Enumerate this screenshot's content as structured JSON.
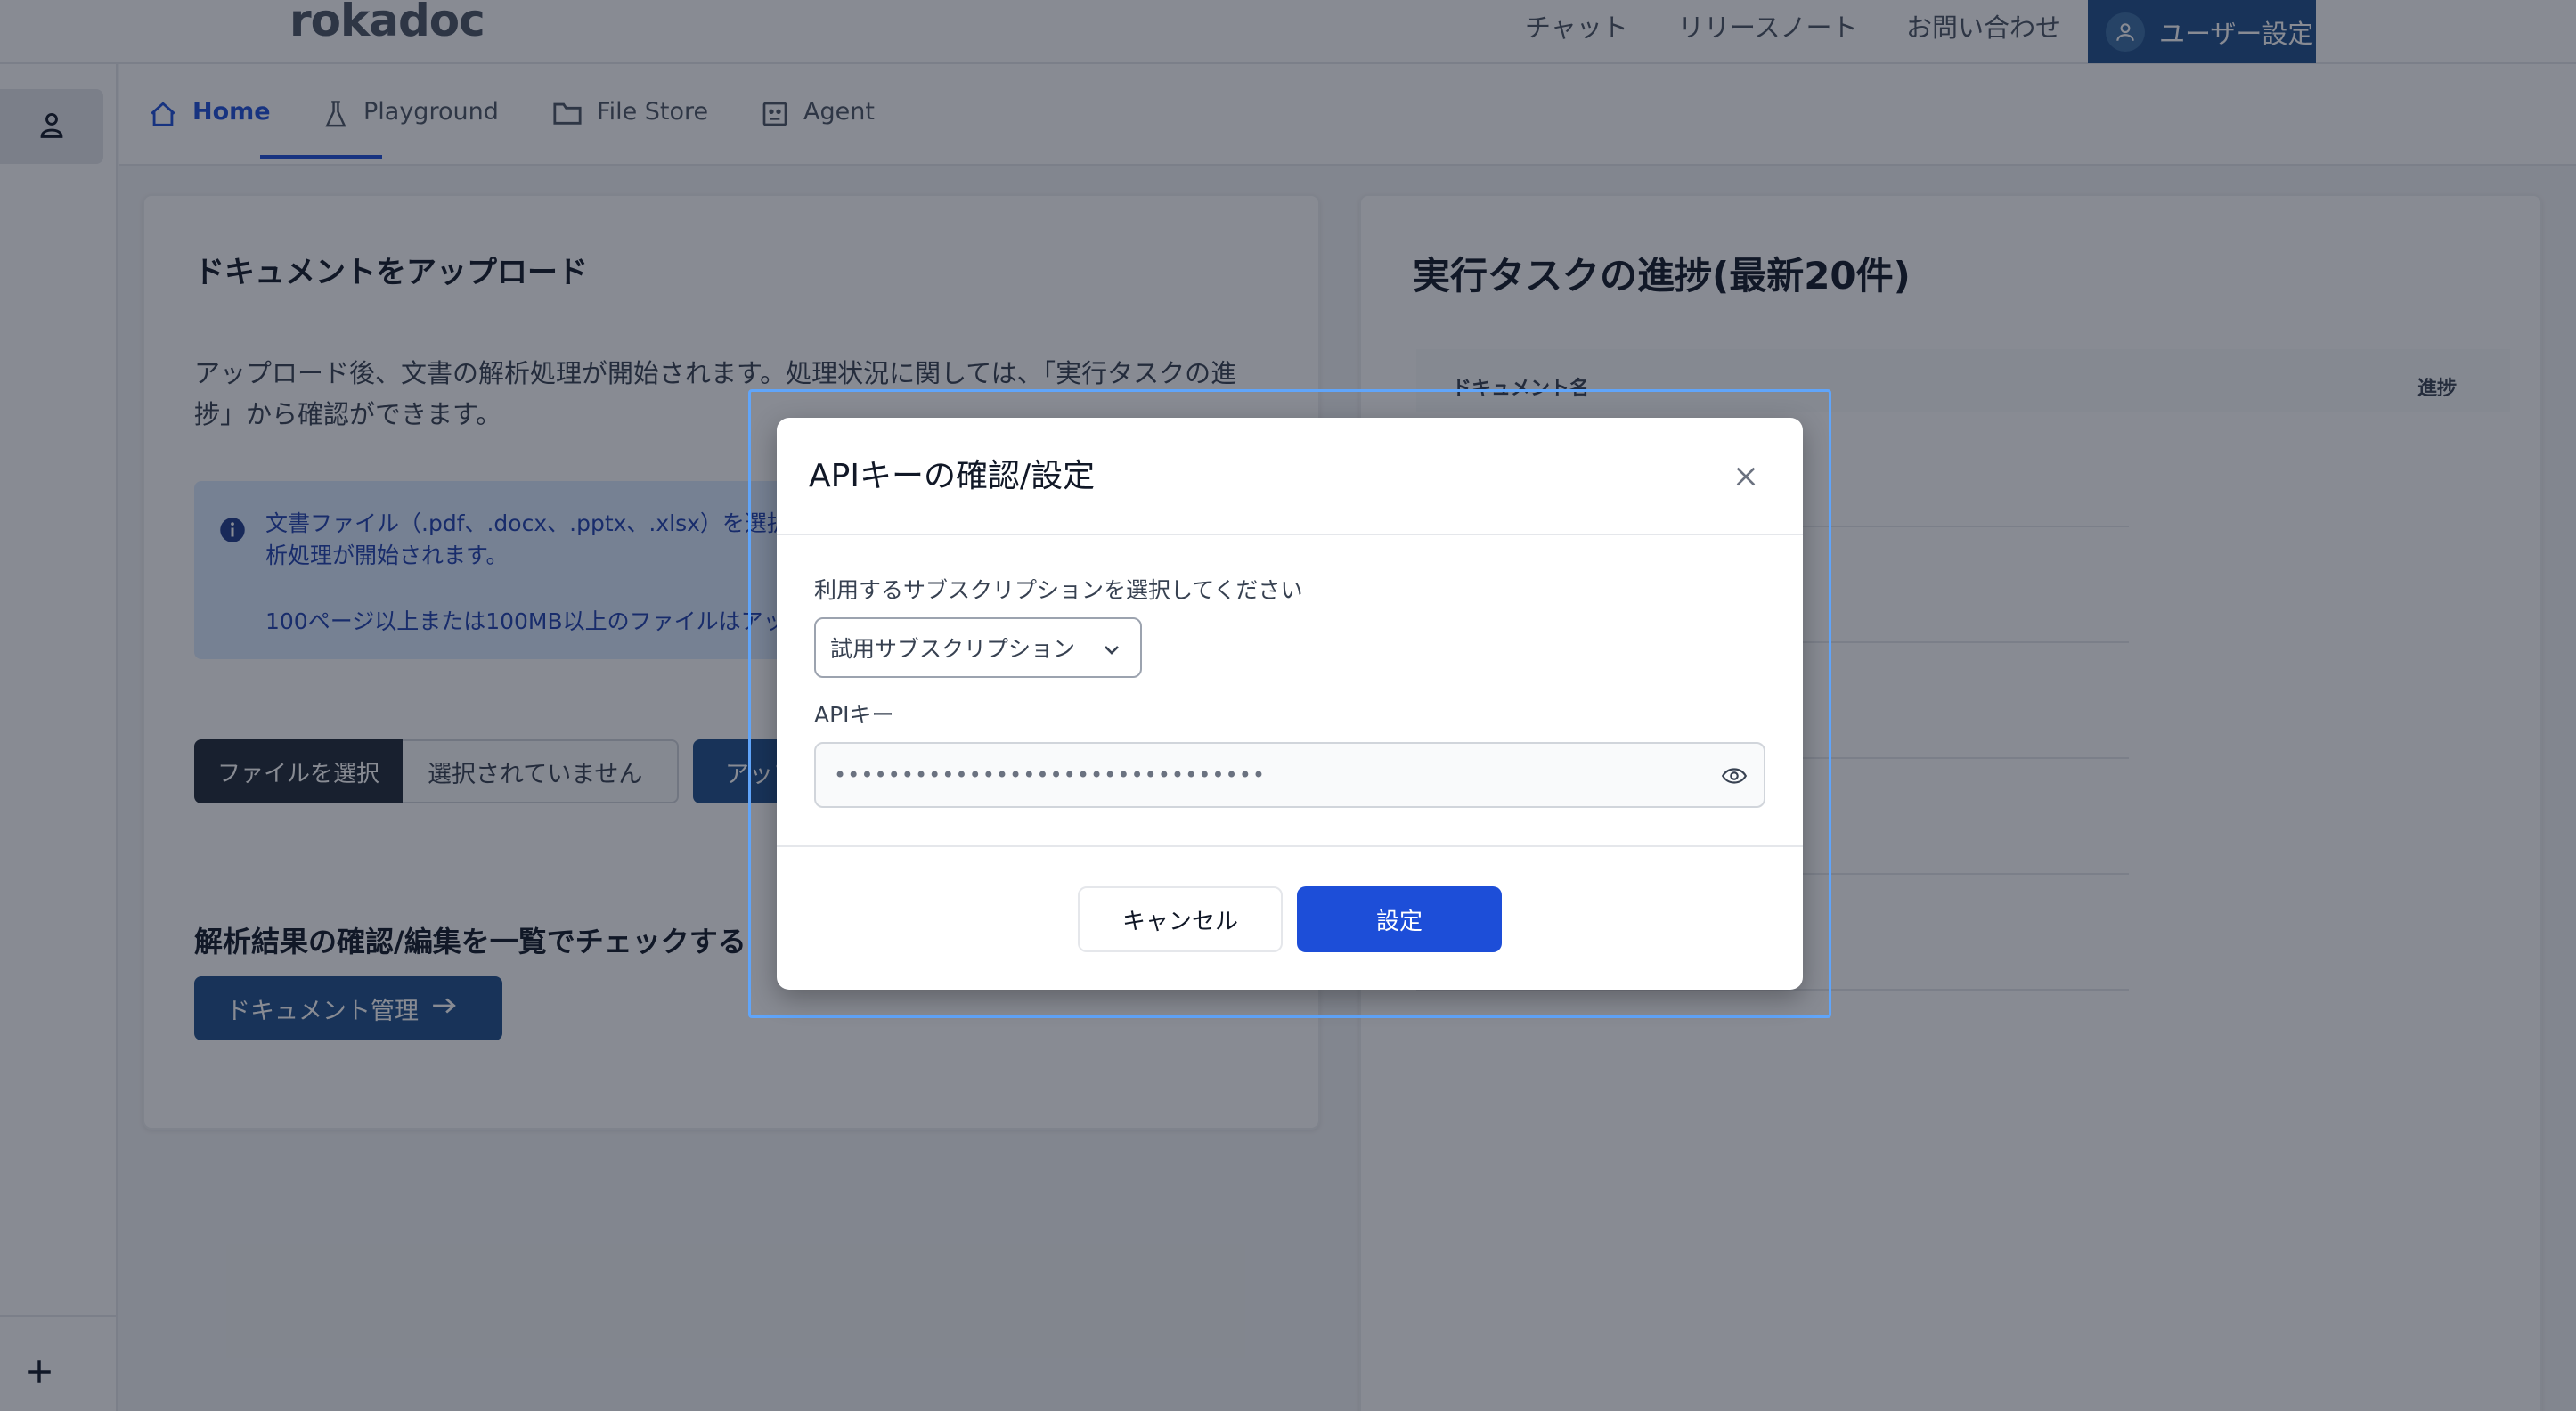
{
  "header": {
    "logo": "rokadoc",
    "nav": [
      "チャット",
      "リリースノート",
      "お問い合わせ"
    ],
    "user_settings": "ユーザー設定"
  },
  "tabs": [
    {
      "label": "Home",
      "icon": "home-icon"
    },
    {
      "label": "Playground",
      "icon": "flask-icon"
    },
    {
      "label": "File Store",
      "icon": "folder-icon"
    },
    {
      "label": "Agent",
      "icon": "agent-icon"
    }
  ],
  "upload_card": {
    "title": "ドキュメントをアップロード",
    "description": "アップロード後、文書の解析処理が開始されます。処理状況に関しては、「実行タスクの進捗」から確認ができます。",
    "info_line1": "文書ファイル（.pdf、.docx、.pptx、.xlsx）を選択",
    "info_line1b": "析処理が開始されます。",
    "info_line2": "100ページ以上または100MB以上のファイルはアッ",
    "choose_file": "ファイルを選択",
    "no_file": "選択されていません",
    "upload_button": "アップ",
    "check_title": "解析結果の確認/編集を一覧でチェックする",
    "doc_manage_button": "ドキュメント管理"
  },
  "task_card": {
    "title": "実行タスクの進捗(最新20件)",
    "col_name": "ドキュメント名",
    "col_progress": "進捗"
  },
  "modal": {
    "title": "APIキーの確認/設定",
    "subscription_label": "利用するサブスクリプションを選択してください",
    "subscription_value": "試用サブスクリプション",
    "api_label": "APIキー",
    "api_value": "••••••••••••••••••••••••••••••••",
    "cancel": "キャンセル",
    "confirm": "設定"
  },
  "colors": {
    "brand": "#1e4f8a",
    "primary": "#1d4ed8",
    "info_bg": "#dbeafe"
  }
}
